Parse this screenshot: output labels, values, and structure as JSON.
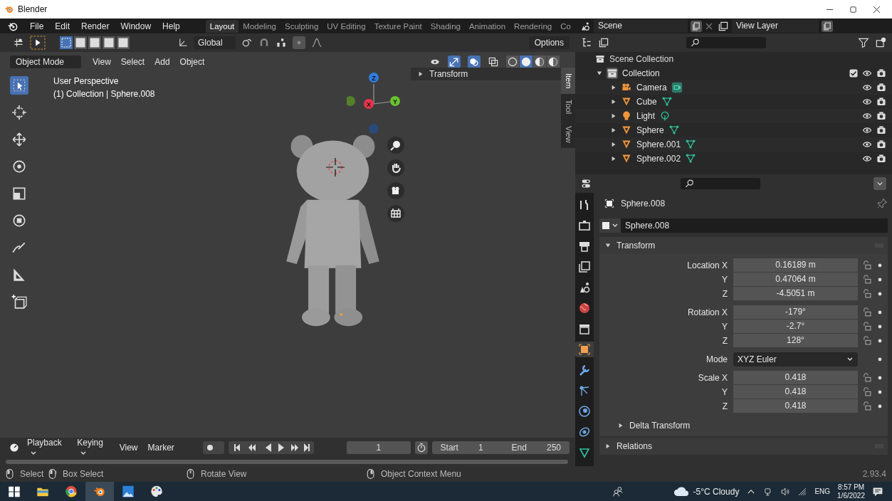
{
  "window": {
    "title": "Blender"
  },
  "menu_bar": {
    "menus": [
      "File",
      "Edit",
      "Render",
      "Window",
      "Help"
    ],
    "workspaces": [
      {
        "label": "Layout",
        "selected": true
      },
      {
        "label": "Modeling",
        "selected": false
      },
      {
        "label": "Sculpting",
        "selected": false
      },
      {
        "label": "UV Editing",
        "selected": false
      },
      {
        "label": "Texture Paint",
        "selected": false
      },
      {
        "label": "Shading",
        "selected": false
      },
      {
        "label": "Animation",
        "selected": false
      },
      {
        "label": "Rendering",
        "selected": false
      },
      {
        "label": "Co",
        "selected": false
      }
    ],
    "scene": "Scene",
    "view_layer": "View Layer"
  },
  "tool_header": {
    "select_modes": [
      {
        "selected": true
      },
      {
        "selected": false
      },
      {
        "selected": false
      },
      {
        "selected": false
      },
      {
        "selected": false
      }
    ],
    "orientation": "Global",
    "options": "Options"
  },
  "viewport": {
    "mode": "Object Mode",
    "menus": [
      "View",
      "Select",
      "Add",
      "Object"
    ],
    "view_name": "User Perspective",
    "collection_info": "(1) Collection | Sphere.008",
    "tools": [
      {
        "kind": "select",
        "selected": true
      },
      {
        "kind": "cursor",
        "selected": false
      },
      {
        "kind": "move",
        "selected": false
      },
      {
        "kind": "rotate",
        "selected": false
      },
      {
        "kind": "scale",
        "selected": false
      },
      {
        "kind": "transform",
        "selected": false
      },
      {
        "kind": "annotate",
        "selected": false
      },
      {
        "kind": "measure",
        "selected": false
      },
      {
        "kind": "add_cube",
        "selected": false
      }
    ],
    "gizmo": [
      {
        "label": "Z"
      },
      {
        "label": "X"
      },
      {
        "label": "Y"
      }
    ],
    "shading": [
      {
        "kind": "wireframe",
        "selected": false
      },
      {
        "kind": "solid",
        "selected": true
      },
      {
        "kind": "material",
        "selected": false
      },
      {
        "kind": "rendered",
        "selected": false
      }
    ]
  },
  "sidebar": {
    "panel": {
      "title": "Transform",
      "expanded": false
    },
    "tabs": [
      {
        "label": "Item",
        "selected": true
      },
      {
        "label": "Tool",
        "selected": false
      },
      {
        "label": "View",
        "selected": false
      }
    ]
  },
  "timeline": {
    "menus": [
      {
        "label": "Playback",
        "dropdown": true
      },
      {
        "label": "Keying",
        "dropdown": true
      },
      {
        "label": "View",
        "dropdown": false
      },
      {
        "label": "Marker",
        "dropdown": false
      }
    ],
    "current_frame": "1",
    "start_label": "Start",
    "start": "1",
    "end_label": "End",
    "end": "250"
  },
  "outliner": {
    "root": "Scene Collection",
    "items": [
      {
        "name": "Collection",
        "kind": "collection",
        "expanded": true,
        "checked": true,
        "children": [
          {
            "name": "Camera",
            "kind": "camera",
            "expanded": false
          },
          {
            "name": "Cube",
            "kind": "mesh",
            "expanded": false
          },
          {
            "name": "Light",
            "kind": "light",
            "expanded": false
          },
          {
            "name": "Sphere",
            "kind": "mesh",
            "expanded": false
          },
          {
            "name": "Sphere.001",
            "kind": "mesh",
            "expanded": false
          },
          {
            "name": "Sphere.002",
            "kind": "mesh",
            "expanded": false
          }
        ]
      }
    ]
  },
  "properties": {
    "tabs": [
      {
        "kind": "tool",
        "selected": false
      },
      {
        "kind": "render",
        "selected": false
      },
      {
        "kind": "output",
        "selected": false
      },
      {
        "kind": "view_layer",
        "selected": false
      },
      {
        "kind": "scene",
        "selected": false
      },
      {
        "kind": "world",
        "selected": false
      },
      {
        "kind": "collection",
        "selected": false
      },
      {
        "kind": "object",
        "selected": true
      },
      {
        "kind": "modifiers",
        "selected": false
      },
      {
        "kind": "particles",
        "selected": false
      },
      {
        "kind": "physics",
        "selected": false
      },
      {
        "kind": "constraints",
        "selected": false
      },
      {
        "kind": "data",
        "selected": false
      }
    ],
    "context": "Sphere.008",
    "object_name": "Sphere.008",
    "transform": {
      "title": "Transform",
      "expanded": true,
      "rows": [
        {
          "kind": "field",
          "label": "Location X",
          "value": "0.16189 m",
          "group_start": true
        },
        {
          "kind": "field",
          "label": "Y",
          "value": "0.47064 m",
          "group_start": false
        },
        {
          "kind": "field",
          "label": "Z",
          "value": "-4.5051 m",
          "group_start": false
        },
        {
          "kind": "field",
          "label": "Rotation X",
          "value": "-179°",
          "group_start": true
        },
        {
          "kind": "field",
          "label": "Y",
          "value": "-2.7°",
          "group_start": false
        },
        {
          "kind": "field",
          "label": "Z",
          "value": "128°",
          "group_start": false
        },
        {
          "kind": "dropdown",
          "label": "Mode",
          "value": "XYZ Euler",
          "group_start": true
        },
        {
          "kind": "field",
          "label": "Scale X",
          "value": "0.418",
          "group_start": true
        },
        {
          "kind": "field",
          "label": "Y",
          "value": "0.418",
          "group_start": false
        },
        {
          "kind": "field",
          "label": "Z",
          "value": "0.418",
          "group_start": false
        }
      ],
      "subpanels": [
        {
          "title": "Delta Transform",
          "expanded": false
        }
      ]
    },
    "panels": [
      {
        "title": "Relations",
        "expanded": false
      }
    ]
  },
  "status_bar": {
    "hints": [
      {
        "kind": "left",
        "label": "Select"
      },
      {
        "kind": "left_drag",
        "label": "Box Select"
      },
      {
        "kind": "middle",
        "label": "Rotate View"
      },
      {
        "kind": "right",
        "label": "Object Context Menu"
      }
    ],
    "version": "2.93.4"
  },
  "taskbar": {
    "apps": [
      {
        "kind": "windows",
        "selected": false
      },
      {
        "kind": "folder",
        "selected": false
      },
      {
        "kind": "browser",
        "selected": false
      },
      {
        "kind": "blender",
        "selected": true
      },
      {
        "kind": "photos",
        "selected": false
      },
      {
        "kind": "paint",
        "selected": false
      }
    ],
    "weather": "-5°C Cloudy",
    "language": "ENG",
    "time": "8:57 PM",
    "date": "1/6/2022"
  }
}
